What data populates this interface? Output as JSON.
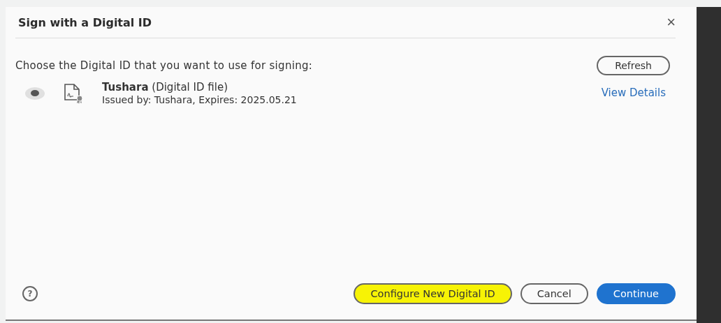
{
  "dialog": {
    "title": "Sign with a Digital ID",
    "close": "×"
  },
  "prompt": "Choose the Digital ID that you want to use for signing:",
  "refresh_button": "Refresh",
  "ids": [
    {
      "name": "Tushara",
      "type": "(Digital ID file)",
      "details": "Issued by: Tushara, Expires: 2025.05.21",
      "link": "View Details",
      "selected": true
    }
  ],
  "help": "?",
  "buttons": [
    {
      "label": "Configure New Digital ID",
      "kind": "outline",
      "highlighted": true
    },
    {
      "label": "Cancel",
      "kind": "outline",
      "highlighted": false
    },
    {
      "label": "Continue",
      "kind": "primary",
      "highlighted": false
    }
  ]
}
